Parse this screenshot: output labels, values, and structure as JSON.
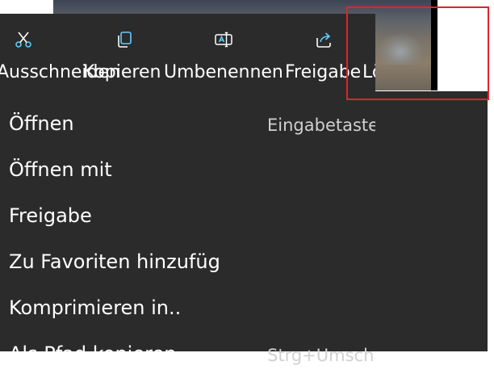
{
  "toolbar": {
    "items": [
      {
        "label": "Ausschneiden",
        "icon": "cut-icon"
      },
      {
        "label": "Kopieren",
        "icon": "copy-icon"
      },
      {
        "label": "Umbenennen",
        "icon": "rename-icon"
      },
      {
        "label": "Freigabe",
        "icon": "share-icon"
      },
      {
        "label": "Löschen",
        "icon": "delete-icon"
      }
    ]
  },
  "menu": {
    "items": [
      {
        "label": "Öffnen",
        "shortcut": "Eingabetaste"
      },
      {
        "label": "Öffnen mit",
        "shortcut": ""
      },
      {
        "label": "Freigabe",
        "shortcut": ""
      },
      {
        "label": "Zu Favoriten hinzufüg",
        "shortcut": ""
      },
      {
        "label": "Komprimieren in..",
        "shortcut": ""
      },
      {
        "label": "Als Pfad kopieren",
        "shortcut": "Strg+Umschalt+C"
      }
    ]
  },
  "colors": {
    "menu_bg": "#2b2b2b",
    "icon_accent": "#60cdff",
    "highlight_border": "#e5212b"
  }
}
